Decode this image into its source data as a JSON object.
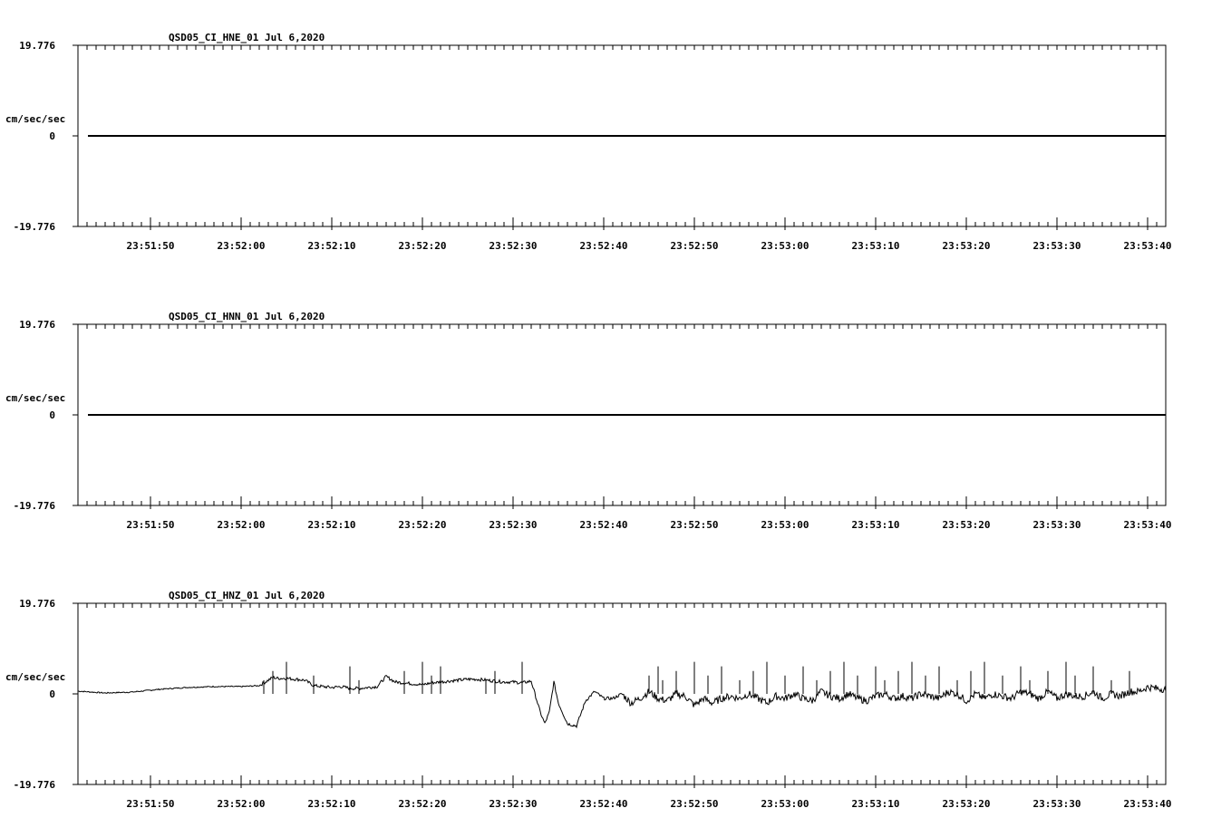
{
  "chart_data": [
    {
      "type": "line",
      "title": "QSD05_CI_HNE_01  Jul 6,2020",
      "ylabel": "cm/sec/sec",
      "ylim": [
        -19.776,
        19.776
      ],
      "yticks": [
        "19.776",
        "0",
        "-19.776"
      ],
      "xticks": [
        "23:51:50",
        "23:52:00",
        "23:52:10",
        "23:52:20",
        "23:52:30",
        "23:52:40",
        "23:52:50",
        "23:53:00",
        "23:53:10",
        "23:53:20",
        "23:53:30",
        "23:53:40"
      ],
      "series": [
        {
          "kind": "flat",
          "value": 0
        }
      ]
    },
    {
      "type": "line",
      "title": "QSD05_CI_HNN_01  Jul 6,2020",
      "ylabel": "cm/sec/sec",
      "ylim": [
        -19.776,
        19.776
      ],
      "yticks": [
        "19.776",
        "0",
        "-19.776"
      ],
      "xticks": [
        "23:51:50",
        "23:52:00",
        "23:52:10",
        "23:52:20",
        "23:52:30",
        "23:52:40",
        "23:52:50",
        "23:53:00",
        "23:53:10",
        "23:53:20",
        "23:53:30",
        "23:53:40"
      ],
      "series": [
        {
          "kind": "flat",
          "value": 0
        }
      ]
    },
    {
      "type": "line",
      "title": "QSD05_CI_HNZ_01  Jul 6,2020",
      "ylabel": "cm/sec/sec",
      "ylim": [
        -19.776,
        19.776
      ],
      "yticks": [
        "19.776",
        "0",
        "-19.776"
      ],
      "xticks": [
        "23:51:50",
        "23:52:00",
        "23:52:10",
        "23:52:20",
        "23:52:30",
        "23:52:40",
        "23:52:50",
        "23:53:00",
        "23:53:10",
        "23:53:20",
        "23:53:30",
        "23:53:40"
      ],
      "series": [
        {
          "kind": "trace",
          "x_seconds_from_23_51_42": [
            0,
            3,
            6,
            9,
            12,
            15,
            18,
            20,
            21.5,
            22,
            23,
            24,
            25,
            26,
            27,
            28,
            29,
            30,
            31,
            32,
            33,
            34,
            35,
            36,
            37,
            38,
            39,
            40,
            41,
            42,
            43,
            44,
            45,
            46,
            47,
            48,
            49,
            50,
            51,
            51.5,
            52,
            52.5,
            53,
            54,
            55,
            56,
            57,
            58,
            59,
            60,
            61,
            62,
            63,
            64,
            65,
            66,
            67,
            68,
            69,
            70,
            71,
            72,
            73,
            74,
            75,
            76,
            77,
            78,
            79,
            80,
            81,
            82,
            83,
            84,
            85,
            86,
            87,
            88,
            89,
            90,
            91,
            92,
            93,
            94,
            95,
            96,
            97,
            98,
            99,
            100,
            101,
            102,
            103,
            104,
            105,
            106,
            107,
            108,
            109,
            110,
            111,
            112,
            113,
            114,
            115,
            116,
            117,
            118,
            119,
            120
          ],
          "y": [
            0.6,
            0.2,
            0.4,
            1.0,
            1.4,
            1.6,
            1.6,
            1.8,
            3.6,
            3.4,
            3.4,
            3.2,
            3.0,
            1.8,
            1.6,
            1.4,
            1.6,
            1.2,
            1.2,
            1.4,
            1.6,
            3.8,
            2.6,
            2.4,
            2.2,
            2.0,
            2.4,
            2.6,
            2.8,
            3.0,
            3.2,
            3.2,
            3.0,
            2.8,
            2.6,
            2.6,
            2.4,
            2.8,
            -4,
            -6.5,
            -4,
            2.6,
            -2,
            -6.5,
            -7,
            -1.5,
            0.5,
            -1,
            -1,
            0,
            -2,
            -1,
            0.5,
            -1,
            -1.5,
            0,
            -0.5,
            -2.5,
            -1,
            -2,
            -1,
            -0.5,
            -1,
            0,
            -1,
            -2,
            -0.5,
            -1,
            0,
            -1,
            -1.5,
            0.5,
            -0.5,
            -1,
            0,
            -1,
            -1.5,
            -0.5,
            0,
            -1,
            -0.5,
            -1,
            0,
            -0.5,
            -1,
            0.5,
            0,
            -1.5,
            0,
            -1,
            0,
            -0.5,
            -1,
            0.5,
            0,
            -1,
            0.5,
            -1,
            0,
            -0.5,
            -0.5,
            0.5,
            -1,
            0,
            -0.5,
            0.5,
            0.5,
            1.5,
            1.2,
            1.0,
            0.6
          ],
          "spikes_up_seconds": [
            20.5,
            21.5,
            23,
            26,
            30,
            31,
            36,
            38,
            39,
            40,
            45,
            46,
            49,
            63,
            64,
            64.5,
            66,
            68,
            69.5,
            71,
            73,
            74.5,
            76,
            78,
            80,
            81.5,
            83,
            84.5,
            86,
            88,
            89,
            90.5,
            92,
            93.5,
            95,
            97,
            98.5,
            100,
            102,
            104,
            105,
            107,
            109,
            110,
            112,
            114,
            116
          ]
        }
      ]
    }
  ]
}
